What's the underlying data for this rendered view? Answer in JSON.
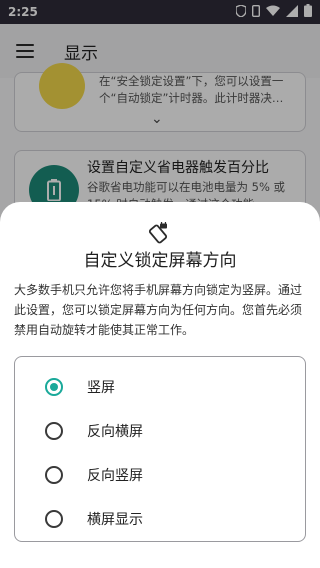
{
  "status_bar": {
    "time": "2:25",
    "icons": [
      "shield-icon",
      "phone-icon",
      "wifi-icon",
      "signal-icon",
      "battery-icon"
    ]
  },
  "app_bar": {
    "title": "显示",
    "menu_icon": "menu-icon"
  },
  "background_cards": [
    {
      "text": "在“安全锁定设置”下，您可以设置一个“自动锁定”计时器。此计时器决…",
      "icon": "timer-icon",
      "icon_color": "#f0d64a",
      "expand_icon": "chevron-down-icon"
    },
    {
      "title": "设置自定义省电器触发百分比",
      "text": "谷歌省电功能可以在电池电量为 5% 或 15% 时自动触发，通过这个功能…",
      "icon": "battery-icon",
      "icon_color": "#1d8a78"
    }
  ],
  "sheet": {
    "icon": "screen-rotation-lock-icon",
    "title": "自定义锁定屏幕方向",
    "description": "大多数手机只允许您将手机屏幕方向锁定为竖屏。通过此设置，您可以锁定屏幕方向为任何方向。您首先必须禁用自动旋转才能使其正常工作。",
    "options": [
      {
        "label": "竖屏",
        "selected": true
      },
      {
        "label": "反向横屏",
        "selected": false
      },
      {
        "label": "反向竖屏",
        "selected": false
      },
      {
        "label": "横屏显示",
        "selected": false
      }
    ],
    "accent_color": "#1aa99a"
  }
}
